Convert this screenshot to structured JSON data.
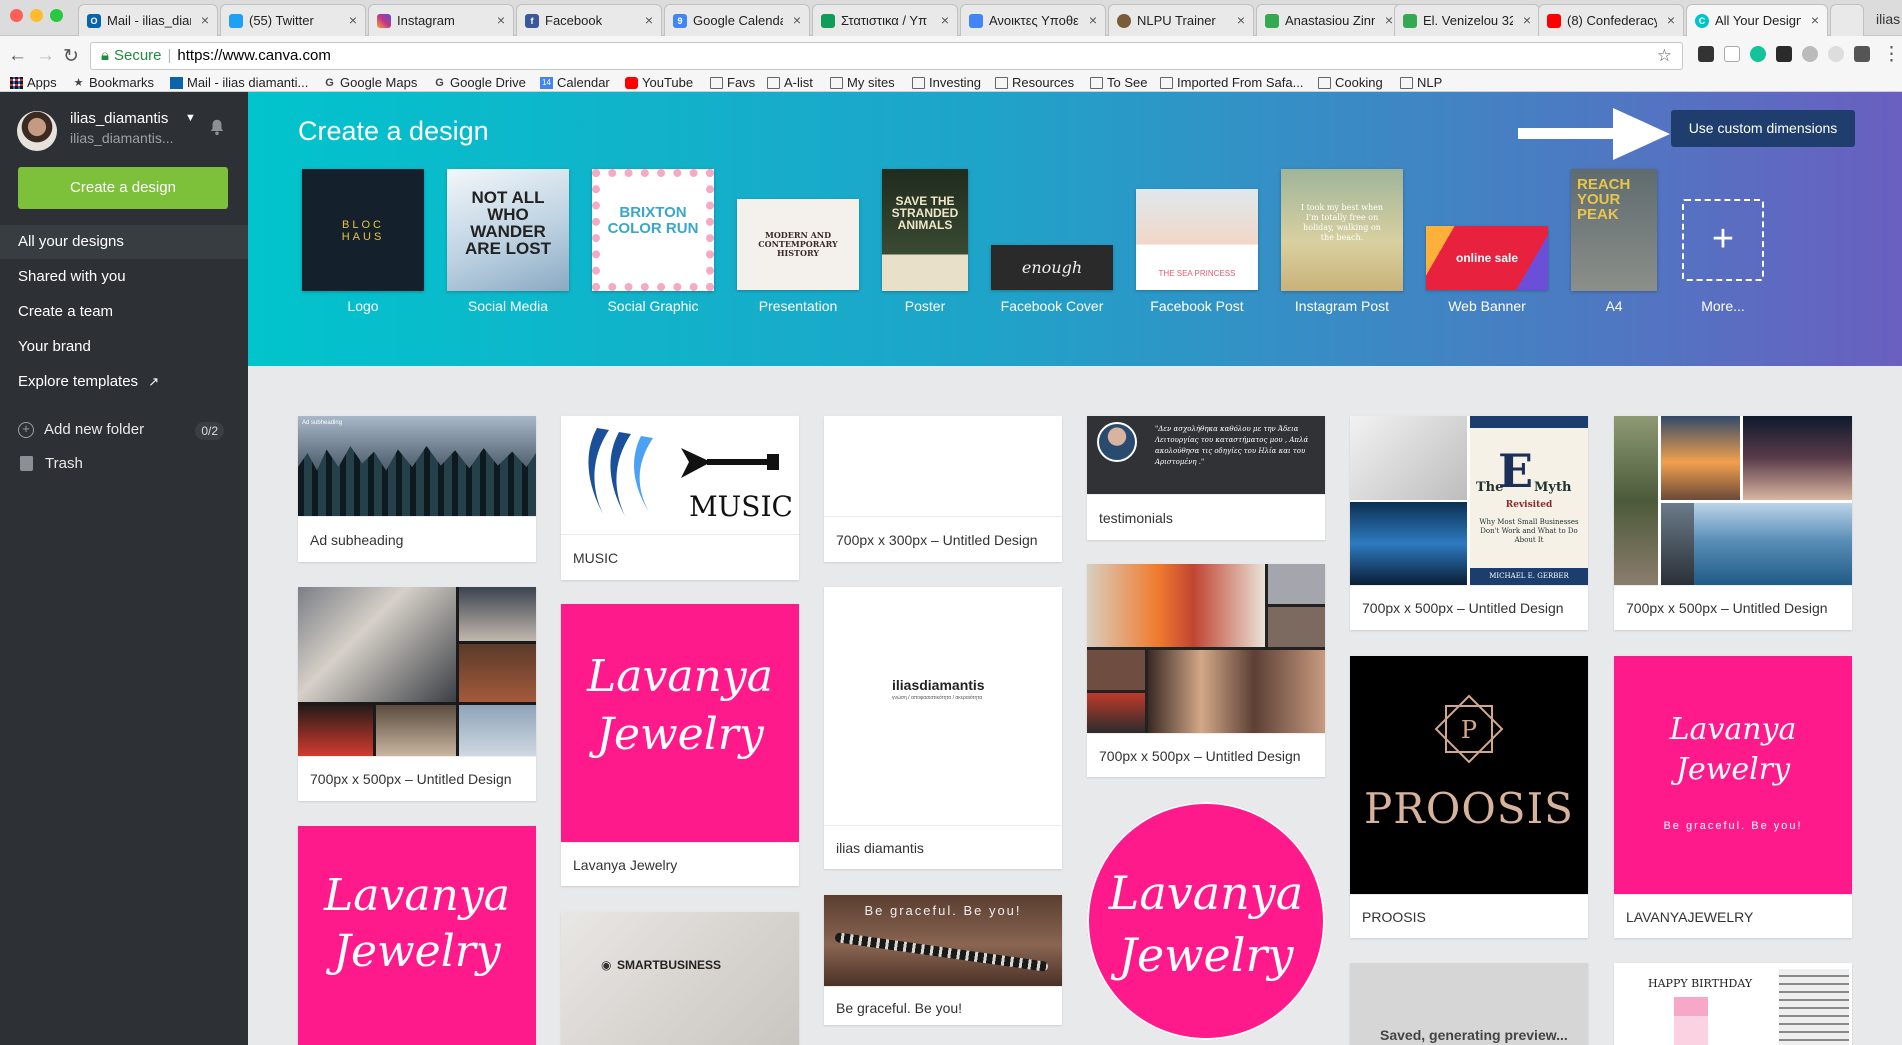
{
  "browser": {
    "tabs": [
      {
        "label": "Mail - ilias_diam",
        "icon": "outlook-icon",
        "color": "#0a64ad",
        "mark": "O"
      },
      {
        "label": "(55) Twitter",
        "icon": "twitter-icon",
        "color": "#1da1f2",
        "mark": ""
      },
      {
        "label": "Instagram",
        "icon": "instagram-icon",
        "color": "#c13584",
        "mark": ""
      },
      {
        "label": "Facebook",
        "icon": "facebook-icon",
        "color": "#3b5998",
        "mark": "f"
      },
      {
        "label": "Google Calenda",
        "icon": "google-calendar-icon",
        "color": "#4285f4",
        "mark": "9"
      },
      {
        "label": "Στατιστικα / Υπ",
        "icon": "google-sheets-icon",
        "color": "#0f9d58",
        "mark": ""
      },
      {
        "label": "Ανοικτες Υποθεσ",
        "icon": "google-docs-icon",
        "color": "#4285f4",
        "mark": ""
      },
      {
        "label": "NLPU Trainer",
        "icon": "nlpu-icon",
        "color": "#7a5c3a",
        "mark": ""
      },
      {
        "label": "Anastasiou Zinn",
        "icon": "google-maps-icon",
        "color": "#34a853",
        "mark": ""
      },
      {
        "label": "El. Venizelou 32",
        "icon": "google-maps-icon",
        "color": "#34a853",
        "mark": ""
      },
      {
        "label": "(8) Confederacy",
        "icon": "youtube-icon",
        "color": "#ff0000",
        "mark": ""
      },
      {
        "label": "All Your Designs",
        "icon": "canva-icon",
        "color": "#00c4cc",
        "mark": "C"
      }
    ],
    "profile": "ilias",
    "url_secure": "Secure",
    "url": "https://www.canva.com",
    "bookmarks": [
      {
        "label": "Apps",
        "icon": "apps-grid-icon"
      },
      {
        "label": "Bookmarks",
        "icon": "star-icon"
      },
      {
        "label": "Mail - ilias diamanti...",
        "icon": "outlook-icon"
      },
      {
        "label": "Google Maps",
        "icon": "google-icon"
      },
      {
        "label": "Google Drive",
        "icon": "google-icon"
      },
      {
        "label": "Calendar",
        "icon": "calendar-icon"
      },
      {
        "label": "YouTube",
        "icon": "youtube-icon"
      },
      {
        "label": "Favs",
        "icon": "folder-icon"
      },
      {
        "label": "A-list",
        "icon": "folder-icon"
      },
      {
        "label": "My sites",
        "icon": "folder-icon"
      },
      {
        "label": "Investing",
        "icon": "folder-icon"
      },
      {
        "label": "Resources",
        "icon": "folder-icon"
      },
      {
        "label": "To See",
        "icon": "folder-icon"
      },
      {
        "label": "Imported From Safa...",
        "icon": "folder-icon"
      },
      {
        "label": "Cooking",
        "icon": "folder-icon"
      },
      {
        "label": "NLP",
        "icon": "folder-icon"
      }
    ]
  },
  "sidebar": {
    "user_name": "ilias_diamantis",
    "user_sub": "ilias_diamantis...",
    "create_label": "Create a design",
    "items": [
      {
        "label": "All your designs"
      },
      {
        "label": "Shared with you"
      },
      {
        "label": "Create a team"
      },
      {
        "label": "Your brand"
      },
      {
        "label": "Explore templates"
      }
    ],
    "add_folder": "Add new folder",
    "folder_count": "0/2",
    "trash": "Trash"
  },
  "hero": {
    "title": "Create a design",
    "custom_button": "Use custom dimensions",
    "templates": [
      {
        "label": "Logo",
        "thumb_text": "BLOC HAUS"
      },
      {
        "label": "Social Media",
        "thumb_text": "NOT ALL WHO WANDER ARE LOST"
      },
      {
        "label": "Social Graphic",
        "thumb_text": "BRIXTON COLOR RUN"
      },
      {
        "label": "Presentation",
        "thumb_text": "MODERN AND CONTEMPORARY HISTORY"
      },
      {
        "label": "Poster",
        "thumb_text": "SAVE THE STRANDED ANIMALS"
      },
      {
        "label": "Facebook Cover",
        "thumb_text": "enough"
      },
      {
        "label": "Facebook Post",
        "thumb_text": "THE SEA PRINCESS"
      },
      {
        "label": "Instagram Post",
        "thumb_text": "I took my best when I'm totally free on holiday, walking on the beach."
      },
      {
        "label": "Web Banner",
        "thumb_text": "online sale"
      },
      {
        "label": "A4",
        "thumb_text": "REACH YOUR PEAK"
      }
    ],
    "more_label": "More..."
  },
  "designs": {
    "cards": [
      {
        "caption": "Ad subheading",
        "thumb_text": "Ad subheading"
      },
      {
        "caption": "MUSIC",
        "thumb_text": "MUSIC"
      },
      {
        "caption": "700px x 300px – Untitled Design",
        "thumb_text": ""
      },
      {
        "caption": "testimonials",
        "thumb_text": "\"Δεν ασχολήθηκα καθόλου με την Άδεια Λειτουργίας του καταστήματος μου , Απλά ακολούθησα τις οδηγίες του Ηλία και του Αριστομένη .\""
      },
      {
        "caption": "700px x 500px – Untitled Design",
        "thumb_text": "The E Myth Revisited"
      },
      {
        "caption": "700px x 500px – Untitled Design",
        "thumb_text": ""
      },
      {
        "caption": "700px x 500px – Untitled Design",
        "thumb_text": ""
      },
      {
        "caption": "Lavanya Jewelry",
        "thumb_text": "Lavanya Jewelry"
      },
      {
        "caption": "ilias diamantis",
        "thumb_text": "iliasdiamantis"
      },
      {
        "caption": "700px x 500px – Untitled Design",
        "thumb_text": ""
      },
      {
        "caption": "PROOSIS",
        "thumb_text": "PROOSIS"
      },
      {
        "caption": "LAVANYAJEWELRY",
        "thumb_text": "Lavanya Jewelry"
      },
      {
        "caption": "",
        "thumb_text": "Lavanya Jewelry"
      },
      {
        "caption": "",
        "thumb_text": "SMARTBUSINESS"
      },
      {
        "caption": "Be graceful. Be you!",
        "thumb_text": "Be graceful. Be you!"
      },
      {
        "caption": "",
        "thumb_text": "Lavanya Jewelry"
      },
      {
        "caption": "Saved, generating preview...",
        "thumb_text": ""
      },
      {
        "caption": "",
        "thumb_text": "HAPPY BIRTHDAY"
      }
    ],
    "e_myth": {
      "the": "The",
      "e": "E",
      "myth": "Myth",
      "revisited": "Revisited",
      "sub": "Why Most Small Businesses Don't Work and What to Do About It",
      "author": "MICHAEL E. GERBER"
    },
    "pink_sub": "Be graceful. Be you!",
    "proosis_letter": "P",
    "ilias_sub": "γνώση / αποφασιστικότητα / ακεραιότητα"
  },
  "colors": {
    "accent_green": "#7dc03a",
    "sidebar_bg": "#2d3135",
    "custom_button_bg": "#1f3e6d",
    "pink": "#ff1a8c"
  }
}
